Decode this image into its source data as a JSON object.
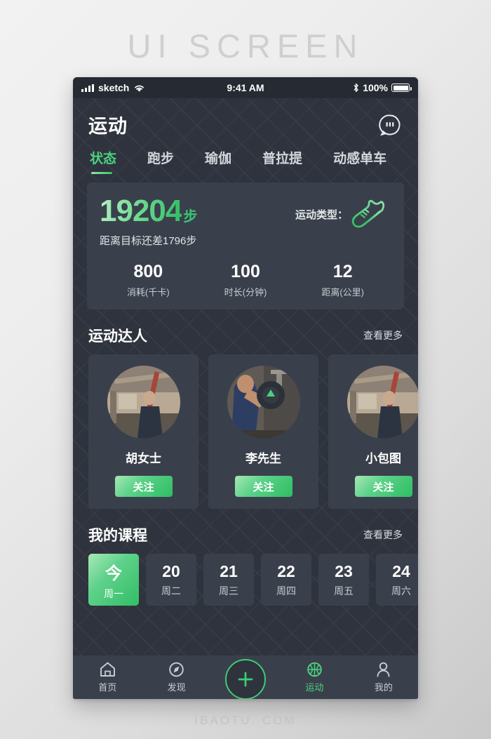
{
  "page": {
    "watermark_title": "UI  SCREEN",
    "watermark_footer": "IBAOTU. COM"
  },
  "status_bar": {
    "carrier": "sketch",
    "time": "9:41 AM",
    "battery_percent": "100%",
    "signal_icon": "signal-bars-icon",
    "wifi_icon": "wifi-icon",
    "bluetooth_icon": "bluetooth-icon",
    "battery_icon": "battery-full-icon"
  },
  "header": {
    "title": "运动",
    "message_icon": "message-bubble-icon"
  },
  "tabs": [
    {
      "label": "状态",
      "active": true
    },
    {
      "label": "跑步",
      "active": false
    },
    {
      "label": "瑜伽",
      "active": false
    },
    {
      "label": "普拉提",
      "active": false
    },
    {
      "label": "动感单车",
      "active": false
    }
  ],
  "stats_card": {
    "steps_value": "19204",
    "steps_unit": "步",
    "goal_text": "距离目标还差1796步",
    "type_label": "运动类型：",
    "type_icon": "running-shoe-icon",
    "metrics": [
      {
        "value": "800",
        "label": "消耗(千卡)"
      },
      {
        "value": "100",
        "label": "时长(分钟)"
      },
      {
        "value": "12",
        "label": "距离(公里)"
      }
    ]
  },
  "athletes_section": {
    "title": "运动达人",
    "more_label": "查看更多",
    "cards": [
      {
        "name": "胡女士",
        "button": "关注"
      },
      {
        "name": "李先生",
        "button": "关注"
      },
      {
        "name": "小包图",
        "button": "关注"
      }
    ]
  },
  "courses_section": {
    "title": "我的课程",
    "more_label": "查看更多",
    "days": [
      {
        "num": "今",
        "weekday": "周一",
        "today": true
      },
      {
        "num": "20",
        "weekday": "周二",
        "today": false
      },
      {
        "num": "21",
        "weekday": "周三",
        "today": false
      },
      {
        "num": "22",
        "weekday": "周四",
        "today": false
      },
      {
        "num": "23",
        "weekday": "周五",
        "today": false
      },
      {
        "num": "24",
        "weekday": "周六",
        "today": false
      }
    ]
  },
  "bottom_nav": {
    "items": [
      {
        "label": "首页",
        "icon": "home-icon",
        "active": false
      },
      {
        "label": "发现",
        "icon": "compass-icon",
        "active": false
      },
      {
        "label": "运动",
        "icon": "basketball-icon",
        "active": true
      },
      {
        "label": "我的",
        "icon": "person-icon",
        "active": false
      }
    ],
    "add_icon": "plus-icon"
  },
  "colors": {
    "accent_green": "#3ecb74",
    "phone_bg": "#2e333d",
    "card_bg": "#3a404b",
    "statusbar_bg": "#262b33"
  }
}
